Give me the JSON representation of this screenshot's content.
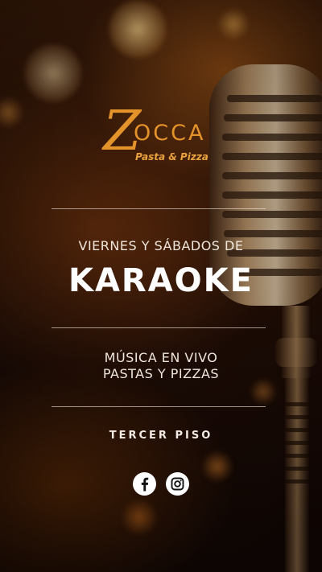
{
  "logo": {
    "initial": "Z",
    "name": "OCCA",
    "tagline": "Pasta & Pizza"
  },
  "event": {
    "days": "VIERNES Y SÁBADOS DE",
    "title": "KARAOKE",
    "features": [
      "MÚSICA EN VIVO",
      "PASTAS Y PIZZAS"
    ],
    "location": "TERCER PISO"
  },
  "social": [
    {
      "icon": "facebook-icon"
    },
    {
      "icon": "instagram-icon"
    }
  ],
  "colors": {
    "brand": "#e3932a",
    "text": "#efe6dc",
    "background": "#2a1206"
  }
}
